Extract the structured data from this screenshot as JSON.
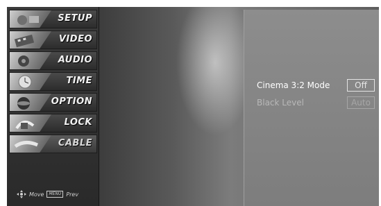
{
  "menu": {
    "items": [
      {
        "label": "SETUP",
        "icon": "setup-picture-icon"
      },
      {
        "label": "VIDEO",
        "icon": "video-picture-icon"
      },
      {
        "label": "AUDIO",
        "icon": "audio-picture-icon"
      },
      {
        "label": "TIME",
        "icon": "clock-picture-icon"
      },
      {
        "label": "OPTION",
        "icon": "option-picture-icon"
      },
      {
        "label": "LOCK",
        "icon": "lock-picture-icon"
      },
      {
        "label": "CABLE",
        "icon": "cable-picture-icon"
      }
    ]
  },
  "hints": {
    "move": "Move",
    "menu_key": "MENU",
    "prev": "Prev"
  },
  "options": {
    "cinema_label": "Cinema 3:2 Mode",
    "cinema_value": "Off",
    "black_label": "Black Level",
    "black_value": "Auto"
  },
  "colors": {
    "panel": "#8a8a8a",
    "sidebar": "#2f2f2f",
    "text": "#ffffff"
  }
}
